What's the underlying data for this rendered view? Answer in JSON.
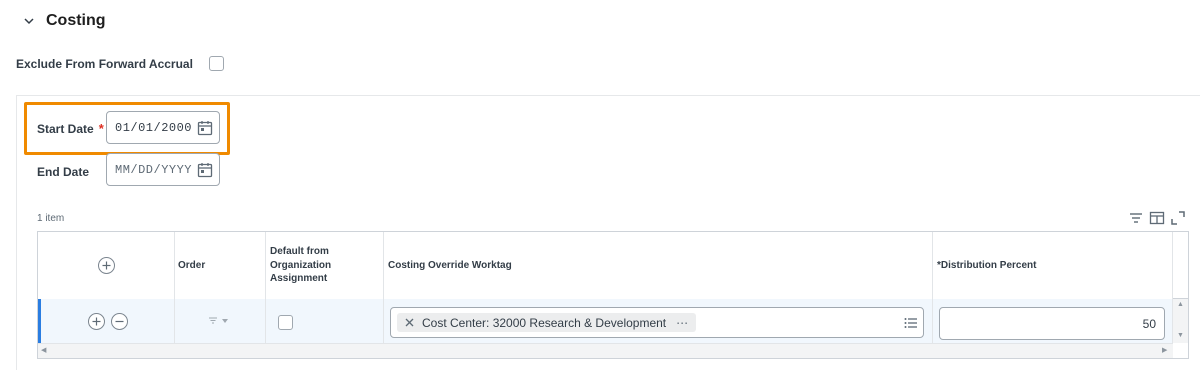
{
  "section": {
    "title": "Costing"
  },
  "exclude": {
    "label": "Exclude From Forward Accrual"
  },
  "start_date": {
    "label": "Start Date",
    "required_mark": "*",
    "value": "01/01/2000"
  },
  "end_date": {
    "label": "End Date",
    "placeholder": "MM/DD/YYYY"
  },
  "grid": {
    "item_count": "1 item",
    "headers": {
      "order": "Order",
      "default_from_org": "Default from Organization Assignment",
      "costing_override": "Costing Override Worktag",
      "distribution_percent": "*Distribution Percent"
    },
    "rows": [
      {
        "worktag": "Cost Center: 32000 Research & Development",
        "worktag_more": "⋯",
        "distribution_percent": "50"
      }
    ]
  },
  "colors": {
    "highlight": "#f08a00",
    "row_accent": "#2a7de1",
    "required": "#de2e21"
  }
}
